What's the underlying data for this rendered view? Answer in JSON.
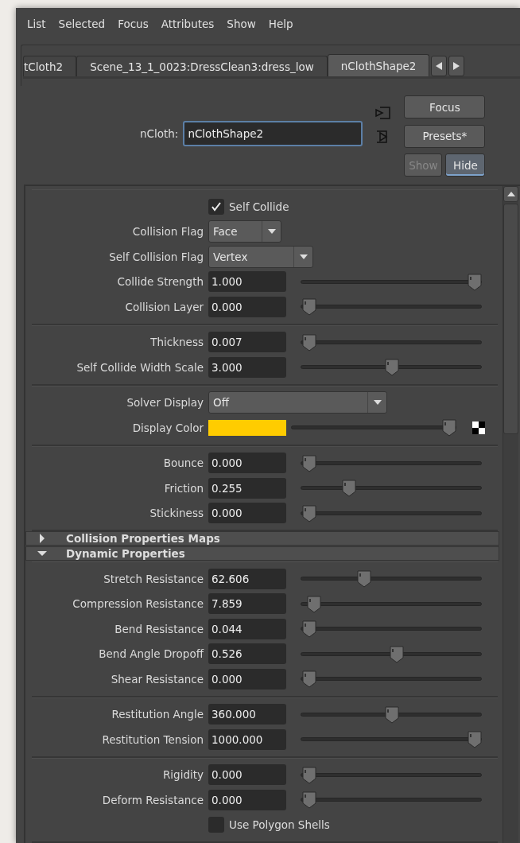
{
  "menu": [
    "List",
    "Selected",
    "Focus",
    "Attributes",
    "Show",
    "Help"
  ],
  "tabs": [
    {
      "label": "tCloth2",
      "selected": false
    },
    {
      "label": "Scene_13_1_0023:DressClean3:dress_low",
      "selected": false
    },
    {
      "label": "nClothShape2",
      "selected": true
    }
  ],
  "node": {
    "label": "nCloth:",
    "value": "nClothShape2"
  },
  "buttons": [
    {
      "label": "Focus",
      "disabled": false,
      "selected": false
    },
    {
      "label": "Presets*",
      "disabled": false,
      "selected": false
    },
    {
      "label": "Show",
      "disabled": true,
      "selected": false
    },
    {
      "label": "Hide",
      "disabled": false,
      "selected": true
    }
  ],
  "blocks": [
    {
      "kind": "group",
      "rows": [
        {
          "kind": "checkbox",
          "label": "Self Collide",
          "checked": true
        },
        {
          "kind": "dropdown",
          "label": "Collision Flag",
          "value": "Face"
        },
        {
          "kind": "dropdown",
          "label": "Self Collision Flag",
          "value": "Vertex"
        },
        {
          "kind": "slider",
          "label": "Collide Strength",
          "value": "1.000",
          "level": 1
        },
        {
          "kind": "slider",
          "label": "Collision Layer",
          "value": "0.000",
          "level": 0
        }
      ]
    },
    {
      "kind": "group",
      "rows": [
        {
          "kind": "slider",
          "label": "Thickness",
          "value": "0.007",
          "level": 0
        },
        {
          "kind": "slider",
          "label": "Self Collide Width Scale",
          "value": "3.000",
          "level": 0.5
        }
      ]
    },
    {
      "kind": "group",
      "rows": [
        {
          "kind": "dropdown",
          "label": "Solver Display",
          "value": "Off"
        },
        {
          "kind": "color",
          "label": "Display Color",
          "color": "#ffcc00",
          "level": 1
        }
      ]
    },
    {
      "kind": "group",
      "rows": [
        {
          "kind": "slider",
          "label": "Bounce",
          "value": "0.000",
          "level": 0
        },
        {
          "kind": "slider",
          "label": "Friction",
          "value": "0.255",
          "level": 0.24
        },
        {
          "kind": "slider",
          "label": "Stickiness",
          "value": "0.000",
          "level": 0
        }
      ]
    },
    {
      "kind": "section",
      "label": "Collision Properties Maps",
      "expanded": false
    },
    {
      "kind": "section",
      "label": "Dynamic Properties",
      "expanded": true
    },
    {
      "kind": "group",
      "rows": [
        {
          "kind": "slider",
          "label": "Stretch Resistance",
          "value": "62.606",
          "level": 0.33
        },
        {
          "kind": "slider",
          "label": "Compression Resistance",
          "value": "7.859",
          "level": 0.03
        },
        {
          "kind": "slider",
          "label": "Bend Resistance",
          "value": "0.044",
          "level": 0
        },
        {
          "kind": "slider",
          "label": "Bend Angle Dropoff",
          "value": "0.526",
          "level": 0.53
        },
        {
          "kind": "slider",
          "label": "Shear Resistance",
          "value": "0.000",
          "level": 0
        }
      ]
    },
    {
      "kind": "group",
      "rows": [
        {
          "kind": "slider",
          "label": "Restitution Angle",
          "value": "360.000",
          "level": 0.5
        },
        {
          "kind": "slider",
          "label": "Restitution Tension",
          "value": "1000.000",
          "level": 1
        }
      ]
    },
    {
      "kind": "group",
      "rows": [
        {
          "kind": "slider",
          "label": "Rigidity",
          "value": "0.000",
          "level": 0
        },
        {
          "kind": "slider",
          "label": "Deform Resistance",
          "value": "0.000",
          "level": 0
        },
        {
          "kind": "checkbox",
          "label": "Use Polygon Shells",
          "checked": false
        }
      ]
    }
  ]
}
